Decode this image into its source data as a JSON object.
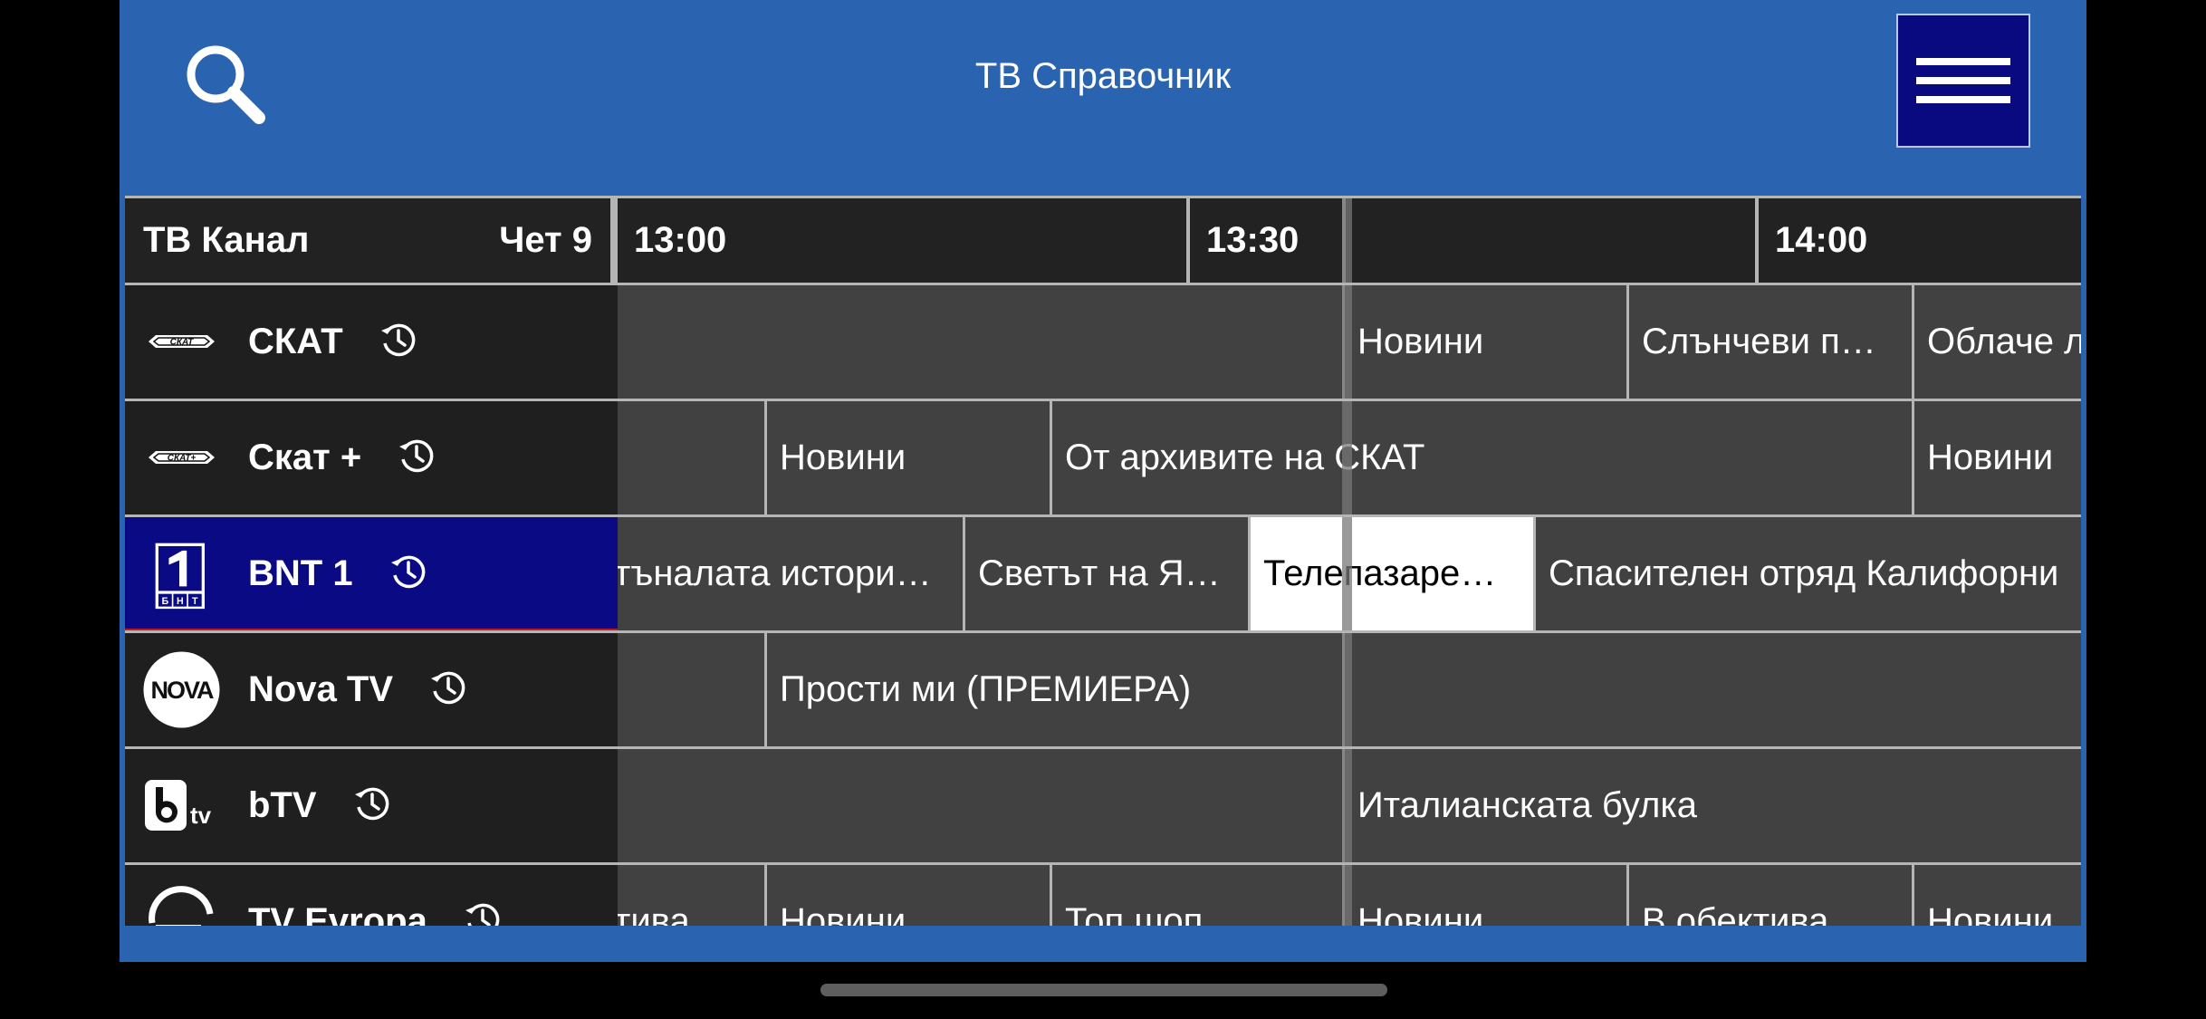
{
  "header": {
    "title": "ТВ Справочник",
    "search_icon": "search-icon",
    "menu_icon": "hamburger-menu-icon"
  },
  "grid": {
    "channel_column_label": "ТВ Канал",
    "day_label": "Чет 9",
    "times": [
      "13:00",
      "13:30",
      "14:00"
    ]
  },
  "channels": [
    {
      "name": "СКАТ",
      "logo": "skat-logo",
      "programs": [
        "Новини",
        "Слънчеви п…",
        "Облаче л"
      ]
    },
    {
      "name": "Скат +",
      "logo": "skat-plus-logo",
      "programs": [
        "Новини",
        "От архивите на СКАТ",
        "Новини"
      ]
    },
    {
      "name": "BNT 1",
      "logo": "bnt1-logo",
      "programs": [
        "тъналата истори…",
        "Светът на Я…",
        "Телепазаре…",
        "Спасителен отряд Калифорни"
      ]
    },
    {
      "name": "Nova TV",
      "logo": "nova-logo",
      "programs": [
        "Прости ми (ПРЕМИЕРА)"
      ]
    },
    {
      "name": "bTV",
      "logo": "btv-logo",
      "programs": [
        "Италианската булка"
      ]
    },
    {
      "name": "TV Evropa",
      "logo": "tv-evropa-logo",
      "programs": [
        "тива",
        "Новини",
        "Топ шоп",
        "Новини",
        "В обектива",
        "Новини"
      ]
    }
  ],
  "colors": {
    "header_bg": "#2a63b0",
    "menu_button_bg": "#0a0a80",
    "active_channel_bg": "#0a0a85",
    "selected_program_bg": "#ffffff"
  }
}
